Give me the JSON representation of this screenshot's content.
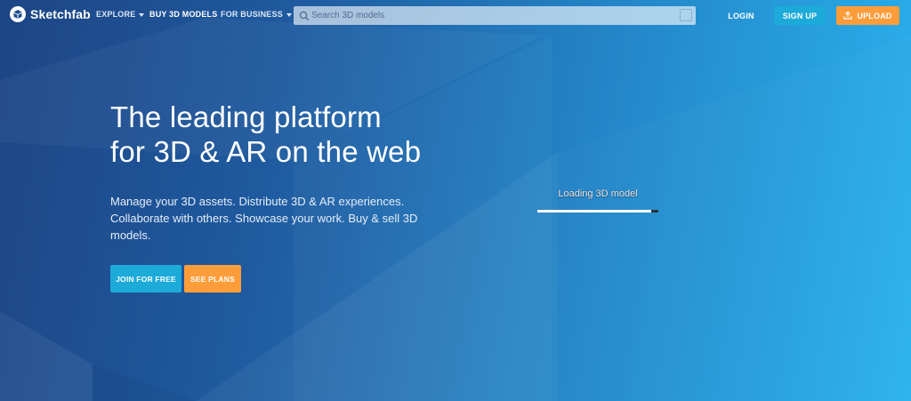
{
  "nav": {
    "logo_text": "Sketchfab",
    "explore": "EXPLORE",
    "buy": "BUY 3D MODELS",
    "business": "FOR BUSINESS",
    "search_placeholder": "Search 3D models",
    "login": "LOGIN",
    "signup": "SIGN UP",
    "upload": "UPLOAD"
  },
  "hero": {
    "title_line1": "The leading platform",
    "title_line2": "for 3D & AR on the web",
    "description": "Manage your 3D assets. Distribute 3D & AR experiences. Collaborate with others. Showcase your work. Buy & sell 3D models.",
    "join_label": "JOIN FOR FREE",
    "plans_label": "SEE PLANS"
  },
  "loader": {
    "text": "Loading 3D model",
    "progress": 0.94
  },
  "colors": {
    "primary": "#1caad9",
    "accent": "#fc9d3a"
  }
}
